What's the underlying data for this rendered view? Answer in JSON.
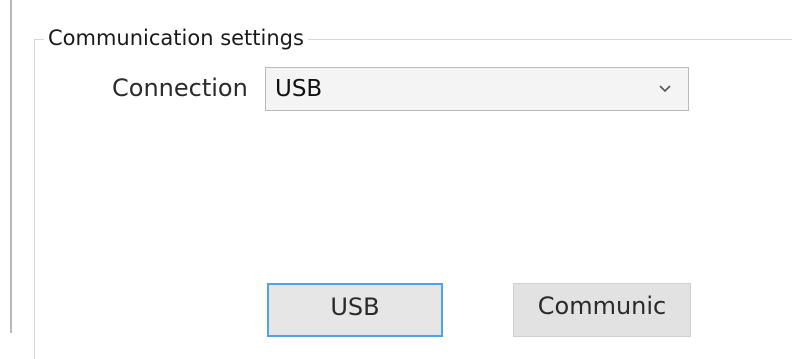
{
  "group": {
    "title": "Communication settings"
  },
  "connection": {
    "label": "Connection",
    "selected_value": "USB",
    "dropdown_icon": "chevron-down-icon"
  },
  "buttons": {
    "usb_label": "USB",
    "communicate_label": "Communic"
  },
  "colors": {
    "focused_button_border": "#4fa3e0",
    "button_background": "#e6e6e6",
    "group_border": "#d6d6d6"
  }
}
